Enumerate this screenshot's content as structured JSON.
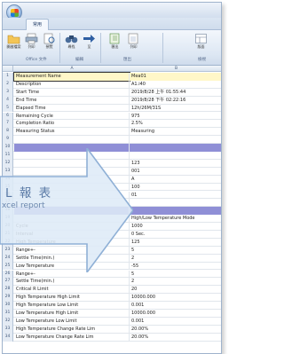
{
  "window": {
    "tab_label": "常用"
  },
  "ribbon": {
    "buttons": [
      {
        "label": "開啟檔案",
        "icon": "folder-open-icon"
      },
      {
        "label": "列印",
        "icon": "printer-icon"
      },
      {
        "label": "預覽",
        "icon": "print-preview-icon"
      },
      {
        "label": "尋找",
        "icon": "binoculars-icon"
      },
      {
        "label": "至",
        "icon": "arrow-right-icon"
      },
      {
        "label": "匯出",
        "icon": "export-icon"
      },
      {
        "label": "列印",
        "icon": "print-icon"
      },
      {
        "label": "版面",
        "icon": "layout-icon"
      }
    ],
    "groups": [
      "Office 文件",
      "編輯",
      "匯出",
      "檢視"
    ]
  },
  "sheet": {
    "columns": [
      "A",
      "B"
    ],
    "rows": [
      {
        "num": "1",
        "a": "Measurement Name",
        "b": "Mea01",
        "style": "header-row"
      },
      {
        "num": "2",
        "a": "Description",
        "b": "A1.i40"
      },
      {
        "num": "3",
        "a": "Start Time",
        "b": "2019/8/28 上午 01:55:44"
      },
      {
        "num": "4",
        "a": "End Time",
        "b": "2019/8/28 下午 02:22:16"
      },
      {
        "num": "5",
        "a": "Elapsed Time",
        "b": "12h/26M/31S"
      },
      {
        "num": "6",
        "a": "Remaining Cycle",
        "b": "975"
      },
      {
        "num": "7",
        "a": "Completion Ratio",
        "b": "2.5%"
      },
      {
        "num": "8",
        "a": "Measuring Status",
        "b": "Measuring"
      },
      {
        "num": "9",
        "a": "",
        "b": ""
      },
      {
        "num": "10",
        "a": "",
        "b": "",
        "style": "band"
      },
      {
        "num": "11",
        "a": "",
        "b": ""
      },
      {
        "num": "12",
        "a": "",
        "b": "123"
      },
      {
        "num": "13",
        "a": "",
        "b": "001"
      },
      {
        "num": "14",
        "a": "",
        "b": "A"
      },
      {
        "num": "15",
        "a": "",
        "b": "100"
      },
      {
        "num": "16",
        "a": "",
        "b": "01"
      },
      {
        "num": "17",
        "a": "",
        "b": ""
      },
      {
        "num": "18",
        "a": "",
        "b": "",
        "style": "band"
      },
      {
        "num": "19",
        "a": "",
        "b": "High/Low Temperature Mode"
      },
      {
        "num": "20",
        "a": "Cycle",
        "b": "1000"
      },
      {
        "num": "21",
        "a": "Interval",
        "b": "0 Sec."
      },
      {
        "num": "22",
        "a": "High Temperature",
        "b": "125"
      },
      {
        "num": "23",
        "a": "Range+-",
        "b": "5"
      },
      {
        "num": "24",
        "a": "Settle Time(min.)",
        "b": "2"
      },
      {
        "num": "25",
        "a": "Low Temperature",
        "b": "-55"
      },
      {
        "num": "26",
        "a": "Range+-",
        "b": "5"
      },
      {
        "num": "27",
        "a": "Settle Time(min.)",
        "b": "2"
      },
      {
        "num": "28",
        "a": "Critical R Limit",
        "b": "20"
      },
      {
        "num": "29",
        "a": "High Temperature High Limit",
        "b": "10000.000"
      },
      {
        "num": "30",
        "a": "High Temperature Low Limit",
        "b": "0.001"
      },
      {
        "num": "31",
        "a": "Low Temperature High Limit",
        "b": "10000.000"
      },
      {
        "num": "32",
        "a": "Low Temperature Low Limit",
        "b": "0.001"
      },
      {
        "num": "33",
        "a": "High Temperature Change Rate Lim",
        "b": "20.00%"
      },
      {
        "num": "34",
        "a": "Low Temperature Change Rate Lim",
        "b": "20.00%"
      }
    ]
  },
  "callout": {
    "title": "L 報 表",
    "subtitle": "xcel report"
  }
}
